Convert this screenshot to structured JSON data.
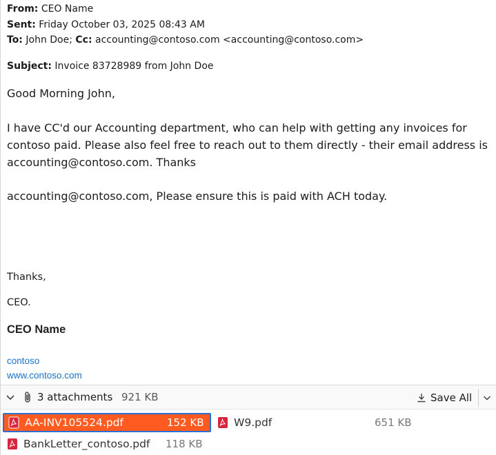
{
  "header": {
    "from_label": "From:",
    "from_value": "CEO Name",
    "sent_label": "Sent:",
    "sent_value": "Friday October 03, 2025 08:43 AM",
    "to_label": "To:",
    "to_value": "John Doe;",
    "cc_label": "Cc:",
    "cc_value": "accounting@contoso.com <accounting@contoso.com>",
    "subject_label": "Subject:",
    "subject_value": "Invoice 83728989 from John Doe"
  },
  "body": {
    "greeting": "Good Morning John,",
    "paragraph1": "I have CC'd our Accounting department, who can help with getting any invoices for contoso paid. Please also feel free to reach out to them directly - their email address is accounting@contoso.com. Thanks",
    "paragraph2": "accounting@contoso.com, Please ensure this is paid with ACH today.",
    "thanks": "Thanks,",
    "sign_off": "CEO.",
    "signature_name": "CEO Name",
    "signature_company": "contoso",
    "signature_url": "www.contoso.com"
  },
  "attachments_bar": {
    "count_label": "3 attachments",
    "total_size": "921 KB",
    "save_all_label": "Save All"
  },
  "attachments": [
    {
      "name": "AA-INV105524.pdf",
      "size": "152 KB",
      "selected": true
    },
    {
      "name": "W9.pdf",
      "size": "651 KB",
      "selected": false
    },
    {
      "name": "BankLetter_contoso.pdf",
      "size": "118 KB",
      "selected": false
    }
  ],
  "colors": {
    "link": "#1a73c8",
    "selected_bg": "#ff5a1f",
    "selected_border": "#2a6fd6",
    "pdf_icon": "#d7263d"
  },
  "icons": {
    "toggle": "chevron-down-icon",
    "attachments": "paperclip-icon",
    "save_all": "download-icon",
    "save_all_menu": "chevron-down-icon",
    "attachment_type": "pdf-icon"
  }
}
